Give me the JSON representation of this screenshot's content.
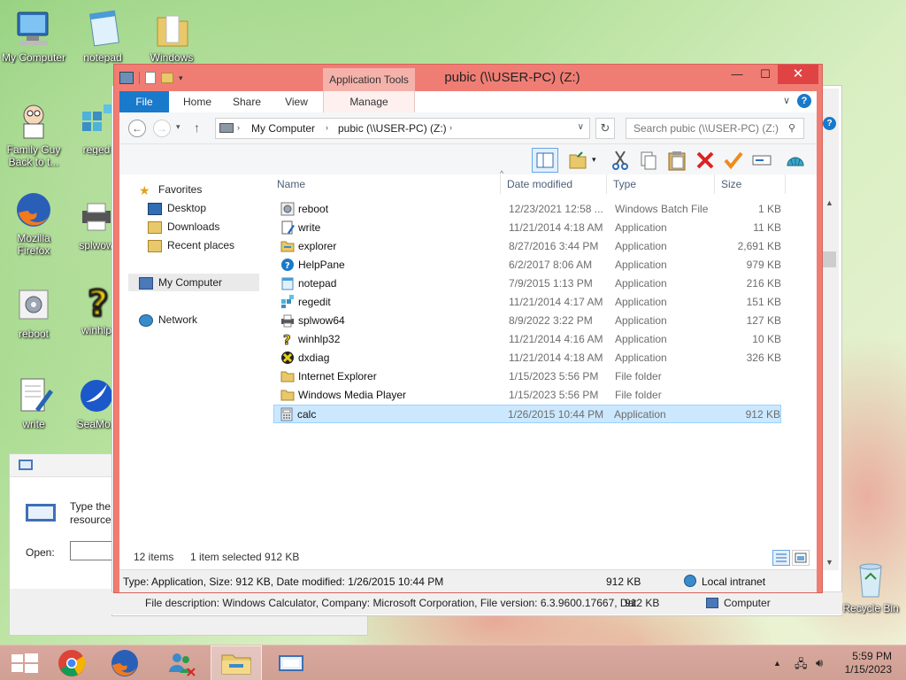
{
  "desktop": {
    "icons": [
      {
        "label": "My Computer"
      },
      {
        "label": "notepad"
      },
      {
        "label": "Windows"
      },
      {
        "label": "Family Guy Back to t..."
      },
      {
        "label": "reged"
      },
      {
        "label": "Mozilla Firefox"
      },
      {
        "label": "splwow"
      },
      {
        "label": "reboot"
      },
      {
        "label": "winhlp"
      },
      {
        "label": "write"
      },
      {
        "label": "SeaMon"
      },
      {
        "label": "Recycle Bin"
      }
    ]
  },
  "run_dialog": {
    "prompt": "Type the",
    "prompt2": "resource,",
    "open_label": "Open:"
  },
  "back_window": {
    "status_description": "File description: Windows Calculator, Company: Microsoft Corporation, File version: 6.3.9600.17667, Dat",
    "status_size": "912 KB",
    "status_location": "Computer"
  },
  "window": {
    "title": "pubic (\\\\USER-PC) (Z:)",
    "context_tab": "Application Tools",
    "tabs": [
      "File",
      "Home",
      "Share",
      "View",
      "Manage"
    ],
    "address": {
      "crumbs": [
        "My Computer",
        "pubic (\\\\USER-PC) (Z:)"
      ]
    },
    "search_placeholder": "Search pubic (\\\\USER-PC) (Z:)",
    "nav": {
      "favorites": "Favorites",
      "desktop": "Desktop",
      "downloads": "Downloads",
      "recent": "Recent places",
      "computer": "My Computer",
      "network": "Network"
    },
    "columns": {
      "name": "Name",
      "date": "Date modified",
      "type": "Type",
      "size": "Size"
    },
    "files": [
      {
        "name": "reboot",
        "date": "12/23/2021 12:58 ...",
        "type": "Windows Batch File",
        "size": "1 KB",
        "icon": "batch-file-icon"
      },
      {
        "name": "write",
        "date": "11/21/2014 4:18 AM",
        "type": "Application",
        "size": "11 KB",
        "icon": "write-app-icon"
      },
      {
        "name": "explorer",
        "date": "8/27/2016 3:44 PM",
        "type": "Application",
        "size": "2,691 KB",
        "icon": "explorer-app-icon"
      },
      {
        "name": "HelpPane",
        "date": "6/2/2017 8:06 AM",
        "type": "Application",
        "size": "979 KB",
        "icon": "help-app-icon"
      },
      {
        "name": "notepad",
        "date": "7/9/2015 1:13 PM",
        "type": "Application",
        "size": "216 KB",
        "icon": "notepad-app-icon"
      },
      {
        "name": "regedit",
        "date": "11/21/2014 4:17 AM",
        "type": "Application",
        "size": "151 KB",
        "icon": "regedit-app-icon"
      },
      {
        "name": "splwow64",
        "date": "8/9/2022 3:22 PM",
        "type": "Application",
        "size": "127 KB",
        "icon": "printer-app-icon"
      },
      {
        "name": "winhlp32",
        "date": "11/21/2014 4:16 AM",
        "type": "Application",
        "size": "10 KB",
        "icon": "winhelp-app-icon"
      },
      {
        "name": "dxdiag",
        "date": "11/21/2014 4:18 AM",
        "type": "Application",
        "size": "326 KB",
        "icon": "dxdiag-app-icon"
      },
      {
        "name": "Internet Explorer",
        "date": "1/15/2023 5:56 PM",
        "type": "File folder",
        "size": "",
        "icon": "folder-icon"
      },
      {
        "name": "Windows Media Player",
        "date": "1/15/2023 5:56 PM",
        "type": "File folder",
        "size": "",
        "icon": "folder-icon"
      },
      {
        "name": "calc",
        "date": "1/26/2015 10:44 PM",
        "type": "Application",
        "size": "912 KB",
        "icon": "calc-app-icon",
        "selected": true
      }
    ],
    "status": {
      "count": "12 items",
      "selected": "1 item selected  912 KB"
    },
    "infobar": {
      "description": "Type: Application, Size: 912 KB, Date modified: 1/26/2015 10:44 PM",
      "size": "912 KB",
      "zone": "Local intranet"
    }
  },
  "taskbar": {
    "time": "5:59 PM",
    "date": "1/15/2023"
  },
  "colors": {
    "window_frame": "#f07d74",
    "file_tab": "#1979ca",
    "selection": "#cce8ff",
    "close_button": "#e04343"
  }
}
